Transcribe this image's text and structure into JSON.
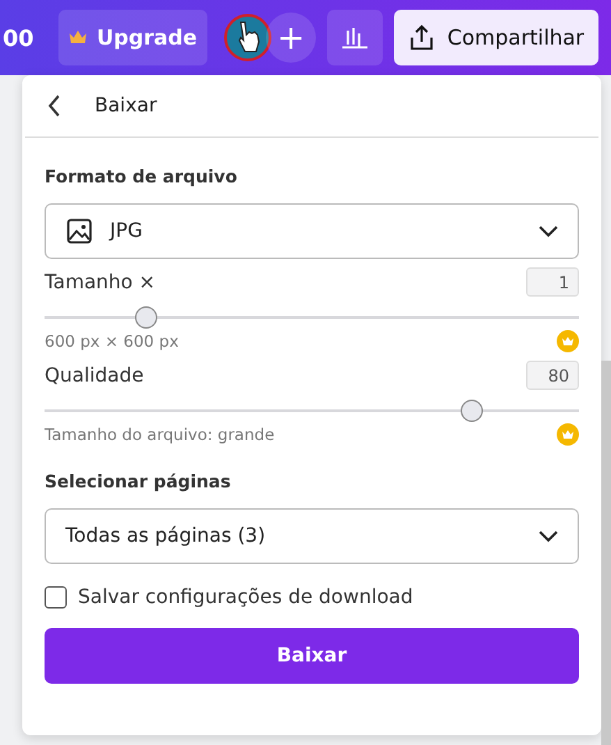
{
  "top_bar": {
    "cut_text": "00",
    "upgrade": "Upgrade",
    "plus": "+",
    "share": "Compartilhar"
  },
  "panel": {
    "title": "Baixar",
    "format": {
      "label": "Formato de arquivo",
      "value": "JPG"
    },
    "size": {
      "label": "Tamanho ×",
      "value": "1",
      "level": 0.19,
      "caption": "600 px × 600 px"
    },
    "quality": {
      "label": "Qualidade",
      "value": "80",
      "level": 0.8,
      "caption": "Tamanho do arquivo: grande"
    },
    "pages": {
      "label": "Selecionar páginas",
      "value": "Todas as páginas (3)"
    },
    "save_settings": {
      "label": "Salvar configurações de download",
      "checked": false
    },
    "button": "Baixar"
  }
}
